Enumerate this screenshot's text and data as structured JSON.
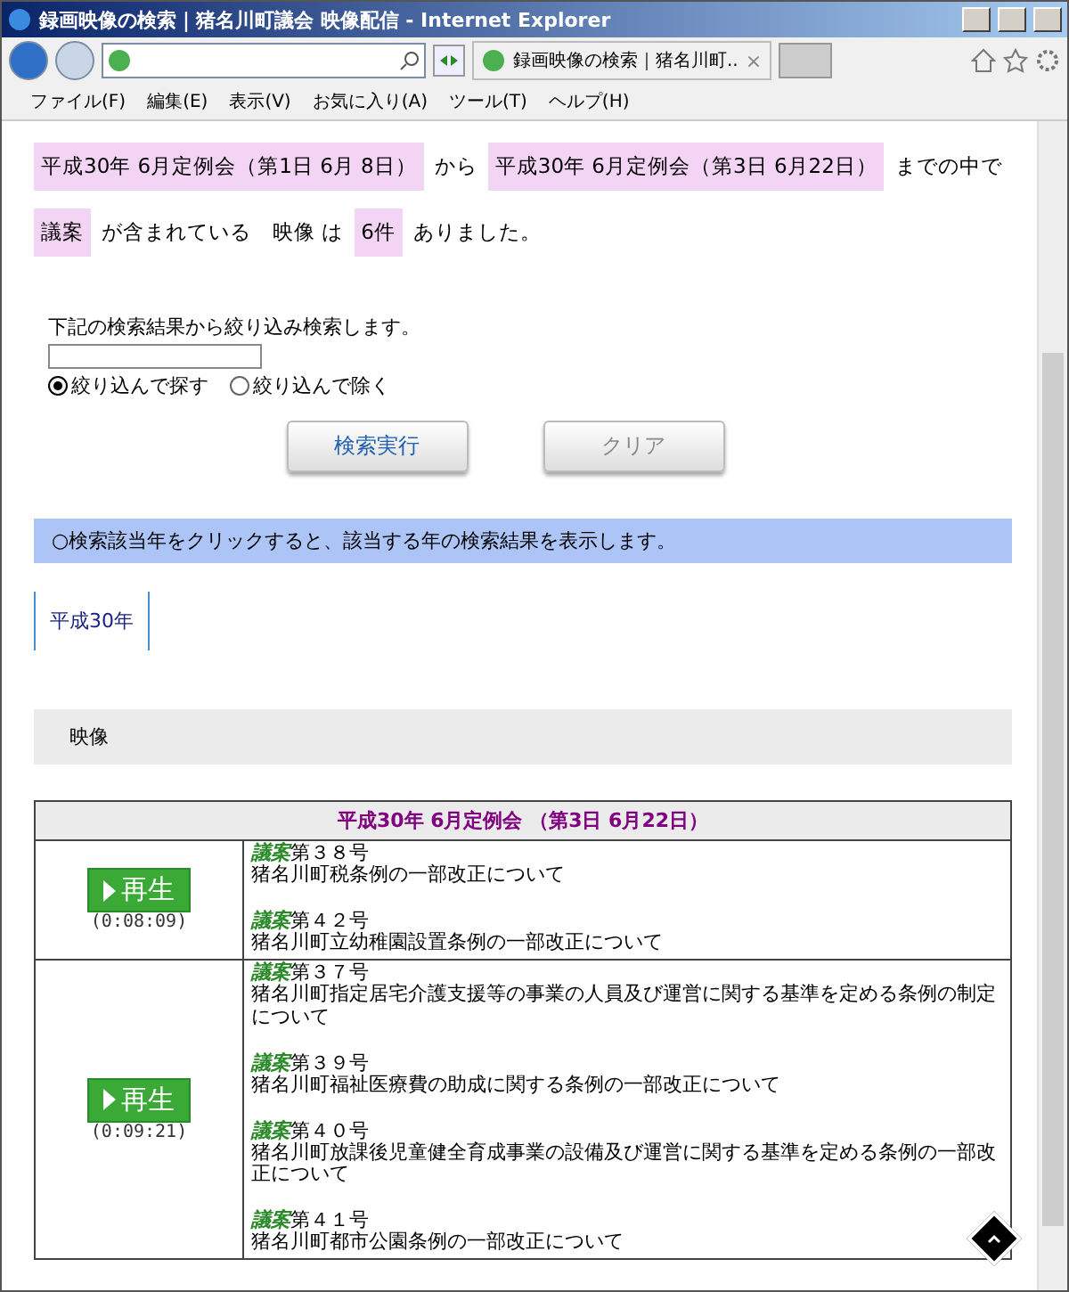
{
  "window": {
    "title": "録画映像の検索｜猪名川町議会 映像配信 - Internet Explorer",
    "tab_title": "録画映像の検索｜猪名川町..",
    "tab_close": "×"
  },
  "menu": [
    "ファイル(F)",
    "編集(E)",
    "表示(V)",
    "お気に入り(A)",
    "ツール(T)",
    "ヘルプ(H)"
  ],
  "summary": {
    "from": "平成30年 6月定例会（第1日 6月 8日）",
    "from_joiner": "から",
    "to": "平成30年 6月定例会（第3日 6月22日）",
    "to_joiner": "までの中で",
    "keyword": "議案",
    "keyword_joiner": "が含まれている",
    "media": "映像 は",
    "count": "6件",
    "ending": "ありました。"
  },
  "filter": {
    "label": "下記の検索結果から絞り込み検索します。",
    "radios": [
      {
        "label": "絞り込んで探す",
        "selected": true
      },
      {
        "label": "絞り込んで除く",
        "selected": false
      }
    ],
    "buttons": [
      {
        "label": "検索実行",
        "kind": "primary"
      },
      {
        "label": "クリア",
        "kind": "secondary"
      }
    ]
  },
  "notice": "○検索該当年をクリックすると、該当する年の検索結果を表示します。",
  "year_tabs": [
    {
      "label": "平成30年",
      "selected": true
    }
  ],
  "section_title": "映像",
  "table": {
    "header": "平成30年 6月定例会 （第3日 6月22日）",
    "rows": [
      {
        "play": "再生",
        "duration": "(0:08:09)",
        "items": [
          {
            "tag": "議案",
            "number": "第３８号",
            "title": "猪名川町税条例の一部改正について"
          },
          {
            "tag": "議案",
            "number": "第４２号",
            "title": "猪名川町立幼稚園設置条例の一部改正について"
          }
        ]
      },
      {
        "play": "再生",
        "duration": "(0:09:21)",
        "items": [
          {
            "tag": "議案",
            "number": "第３７号",
            "title": "猪名川町指定居宅介護支援等の事業の人員及び運営に関する基準を定める条例の制定について"
          },
          {
            "tag": "議案",
            "number": "第３９号",
            "title": "猪名川町福祉医療費の助成に関する条例の一部改正について"
          },
          {
            "tag": "議案",
            "number": "第４０号",
            "title": "猪名川町放課後児童健全育成事業の設備及び運営に関する基準を定める条例の一部改正について"
          },
          {
            "tag": "議案",
            "number": "第４１号",
            "title": "猪名川町都市公園条例の一部改正について"
          }
        ]
      }
    ]
  }
}
